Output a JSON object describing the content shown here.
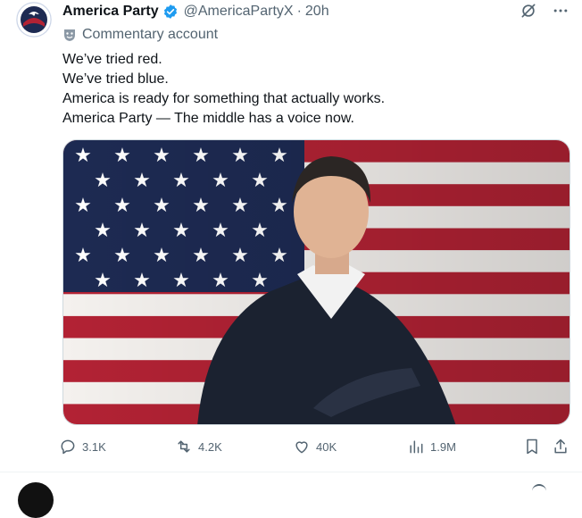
{
  "tweet": {
    "display_name": "America Party",
    "handle": "@AmericaPartyX",
    "separator": "·",
    "time": "20h",
    "account_label": "Commentary account",
    "text_lines": [
      "We’ve tried red.",
      "We’ve tried blue.",
      "America is ready for something that actually works.",
      "America Party — The middle has a voice now."
    ],
    "actions": {
      "replies": "3.1K",
      "reposts": "4.2K",
      "likes": "40K",
      "views": "1.9M"
    }
  },
  "icons": {
    "verified": "verified-badge-icon",
    "grok": "grok-icon",
    "more": "more-icon",
    "label": "commentary-mask-icon",
    "reply": "reply-icon",
    "repost": "repost-icon",
    "like": "like-icon",
    "views": "views-icon",
    "bookmark": "bookmark-icon",
    "share": "share-icon"
  },
  "colors": {
    "accent": "#1d9bf0",
    "text": "#0f1419",
    "muted": "#536471",
    "flag_red": "#b22234",
    "flag_blue": "#1d2a52"
  }
}
